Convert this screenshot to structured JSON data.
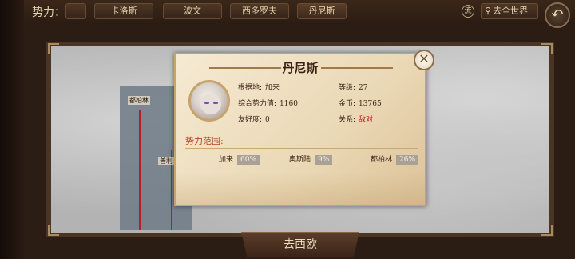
{
  "topbar": {
    "faction_label": "势力：",
    "tabs": [
      "卡洛斯",
      "波文",
      "西多罗夫",
      "丹尼斯"
    ],
    "round_icon_text": "流",
    "world_button": "去全世界"
  },
  "map": {
    "cities": [
      "都柏林",
      "普利"
    ]
  },
  "dialog": {
    "title": "丹尼斯",
    "base_label": "根据地:",
    "base_value": "加来",
    "level_label": "等级:",
    "level_value": "27",
    "power_label": "综合势力值:",
    "power_value": "1160",
    "gold_label": "金币:",
    "gold_value": "13765",
    "friendship_label": "友好度:",
    "friendship_value": "0",
    "relation_label": "关系:",
    "relation_value": "敌对",
    "relation_color": "#c02020",
    "territory_title": "势力范围:",
    "territories": [
      {
        "name": "加来",
        "pct": "60%"
      },
      {
        "name": "奥斯陆",
        "pct": "9%"
      },
      {
        "name": "都柏林",
        "pct": "26%"
      }
    ]
  },
  "bottom": {
    "goto_button": "去西欧"
  }
}
